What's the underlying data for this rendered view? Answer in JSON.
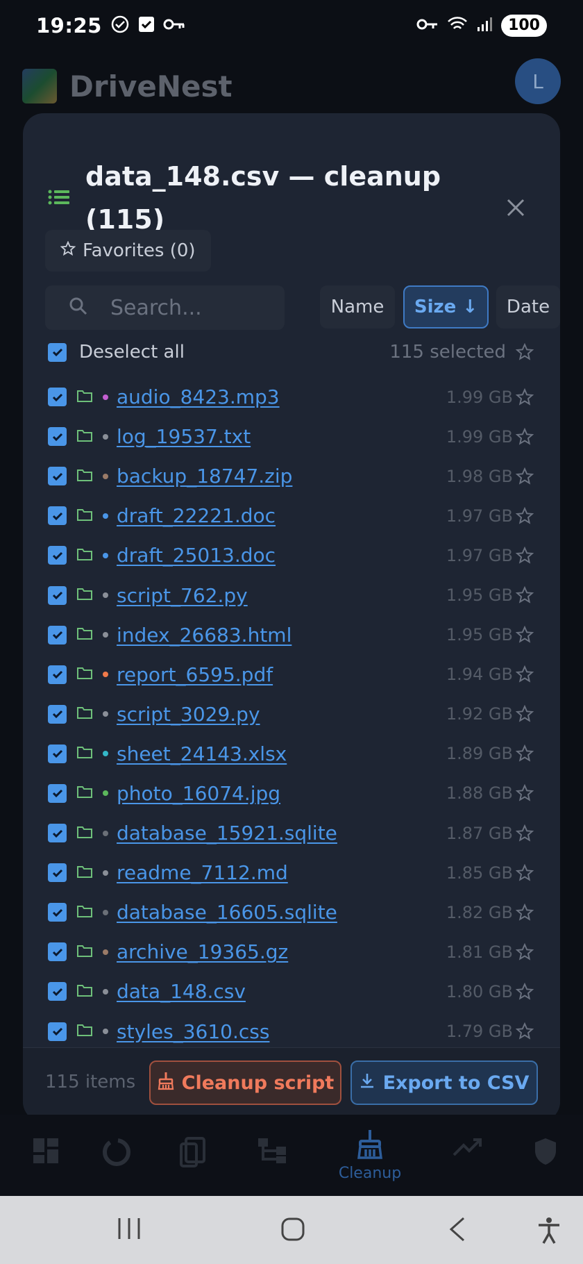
{
  "status_bar": {
    "time": "19:25",
    "battery": "100"
  },
  "app": {
    "title": "DriveNest",
    "avatar_initial": "L"
  },
  "modal": {
    "title": "data_148.csv — cleanup (115)",
    "favorites_label": "Favorites (0)",
    "search_placeholder": "Search...",
    "sort_buttons": {
      "name": "Name",
      "size": "Size ↓",
      "date": "Date"
    },
    "active_sort": "size",
    "deselect_label": "Deselect all",
    "selected_count": "115 selected",
    "files": [
      {
        "name": "audio_8423.mp3",
        "size": "1.99 GB",
        "dot": "#c35fd1"
      },
      {
        "name": "log_19537.txt",
        "size": "1.99 GB",
        "dot": "#8a8f98"
      },
      {
        "name": "backup_18747.zip",
        "size": "1.98 GB",
        "dot": "#9a7b68"
      },
      {
        "name": "draft_22221.doc",
        "size": "1.97 GB",
        "dot": "#4a96e8"
      },
      {
        "name": "draft_25013.doc",
        "size": "1.97 GB",
        "dot": "#4a96e8"
      },
      {
        "name": "script_762.py",
        "size": "1.95 GB",
        "dot": "#8a8f98"
      },
      {
        "name": "index_26683.html",
        "size": "1.95 GB",
        "dot": "#8a8f98"
      },
      {
        "name": "report_6595.pdf",
        "size": "1.94 GB",
        "dot": "#f07a4a"
      },
      {
        "name": "script_3029.py",
        "size": "1.92 GB",
        "dot": "#8a8f98"
      },
      {
        "name": "sheet_24143.xlsx",
        "size": "1.89 GB",
        "dot": "#34b8c8"
      },
      {
        "name": "photo_16074.jpg",
        "size": "1.88 GB",
        "dot": "#5cb85c"
      },
      {
        "name": "database_15921.sqlite",
        "size": "1.87 GB",
        "dot": "#6b7078"
      },
      {
        "name": "readme_7112.md",
        "size": "1.85 GB",
        "dot": "#8a8f98"
      },
      {
        "name": "database_16605.sqlite",
        "size": "1.82 GB",
        "dot": "#6b7078"
      },
      {
        "name": "archive_19365.gz",
        "size": "1.81 GB",
        "dot": "#9a7b68"
      },
      {
        "name": "data_148.csv",
        "size": "1.80 GB",
        "dot": "#8a8f98"
      },
      {
        "name": "styles_3610.css",
        "size": "1.79 GB",
        "dot": "#8a8f98"
      }
    ],
    "footer": {
      "items_count": "115 items",
      "cleanup_label": "Cleanup script",
      "export_label": "Export to CSV"
    }
  },
  "bottom_nav": {
    "active_label": "Cleanup",
    "items": [
      "dashboard-icon",
      "loader-icon",
      "devices-icon",
      "hierarchy-icon",
      "broom-icon",
      "trending-icon",
      "shield-icon"
    ]
  },
  "colors": {
    "accent": "#4a96e8",
    "cleanup_accent": "#f07a5c",
    "folder_green": "#6ec07a",
    "modal_bg": "#1e2533"
  }
}
